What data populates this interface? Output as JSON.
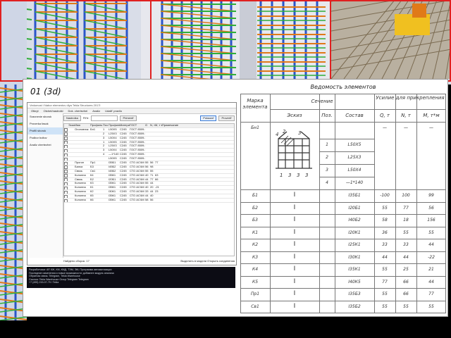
{
  "slide": {
    "title": "01 (3d)"
  },
  "app": {
    "window_title": "Vedomost i Nabor elementov dlya Tekla Structures 2017i",
    "menu": [
      "Otkryt",
      "Otchet/nastroiki",
      "Dok. chertezhei",
      "Analiz",
      "Udalit' pravilo"
    ],
    "sidebar": [
      "Sravnenie sborok",
      "Proverka fasok",
      "Profili sborok",
      "Podbor boltov",
      "Analiz chertezhei"
    ],
    "sidebar_selected": 2,
    "toolbar": {
      "settings": "Nastroika",
      "filter_label": "Fil'tr:",
      "apply": "Primenit'",
      "load": "Pokazat'",
      "check": "Proverit'"
    },
    "grid_headers": [
      "",
      "Эскиз",
      "Имя",
      "Профиль",
      "Поз",
      "Профиль",
      "Материал",
      "ГОСТ",
      "G",
      "N, т",
      "M, т·м",
      "Примечание"
    ],
    "grid_rows": [
      [
        "",
        "",
        "Оголовник",
        "Бн1",
        "1",
        "L50X5",
        "С245",
        "ГОСТ 8509-93",
        "",
        "",
        "",
        ""
      ],
      [
        "",
        "",
        "",
        "",
        "2",
        "L25X3",
        "С245",
        "ГОСТ 8509-93",
        "",
        "",
        "",
        ""
      ],
      [
        "",
        "",
        "",
        "",
        "3",
        "L50X4",
        "С245",
        "ГОСТ 8509-93",
        "",
        "",
        "",
        ""
      ],
      [
        "",
        "",
        "",
        "",
        "1",
        "L50X5",
        "С245",
        "ГОСТ 8509-93",
        "",
        "",
        "",
        ""
      ],
      [
        "",
        "",
        "",
        "",
        "2",
        "L25X3",
        "С245",
        "ГОСТ 8509-93",
        "",
        "",
        "",
        ""
      ],
      [
        "",
        "",
        "",
        "",
        "3",
        "L50X4",
        "С245",
        "ГОСТ 8509-93",
        "",
        "",
        "",
        ""
      ],
      [
        "",
        "",
        "",
        "",
        "4",
        "—1*140",
        "С245",
        "ГОСТ 8509-93",
        "",
        "",
        "",
        ""
      ],
      [
        "",
        "",
        "",
        "",
        "",
        "L50X5",
        "С245",
        "ГОСТ 8509-93",
        "",
        "",
        "",
        ""
      ],
      [
        "",
        "",
        "Прогон",
        "Пр1",
        "",
        "I35Б1",
        "С245",
        "СТО АСЧМ 20-93",
        "55",
        "56",
        "77",
        ""
      ],
      [
        "",
        "",
        "Балка",
        "Б3",
        "",
        "I45Б2",
        "С245",
        "СТО АСЧМ 20-93",
        "56",
        "98",
        "",
        ""
      ],
      [
        "",
        "",
        "Связь",
        "Св1",
        "",
        "I45Б2",
        "С245",
        "СТО АСЧМ 20-93",
        "55",
        "55",
        "",
        ""
      ],
      [
        "",
        "",
        "Колонна",
        "К4",
        "",
        "I35К1",
        "С245",
        "СТО АСЧМ 20-93",
        "40",
        "71",
        "63",
        ""
      ],
      [
        "",
        "",
        "Связь",
        "Б2",
        "",
        "I20Б1",
        "С245",
        "СТО АСЧМ 20-93",
        "44",
        "77",
        "66",
        ""
      ],
      [
        "",
        "",
        "Колонна",
        "К3",
        "",
        "I35К1",
        "С245",
        "СТО АСЧМ 20-93",
        "55",
        "44",
        "",
        ""
      ],
      [
        "",
        "",
        "Колонна",
        "К1",
        "",
        "I35К1",
        "С245",
        "СТО АСЧМ 20-93",
        "40",
        "20",
        "-21",
        ""
      ],
      [
        "",
        "",
        "Колонна",
        "К2",
        "",
        "I30К1",
        "С245",
        "СТО АСЧМ 20-93",
        "33",
        "44",
        "23",
        ""
      ],
      [
        "",
        "",
        "Колонна",
        "К5",
        "",
        "I35К1",
        "С245",
        "СТО АСЧМ 20-93",
        "44",
        "40",
        "",
        ""
      ],
      [
        "",
        "",
        "Колонна",
        "К6",
        "",
        "I35К1",
        "С245",
        "СТО АСЧМ 20-93",
        "58",
        "56",
        "",
        ""
      ]
    ],
    "footer_left": "Найдено сборок: 17",
    "footer_right": "Выделить в модели    Открыть соединения"
  },
  "console_lines": [
    "Разработчики: АР, КЖ, КМ, КМД, ТЭМ, ЭМ, Программа автоматизации",
    "Последние изменения и новые возможности: добавлен модуль анализа",
    "Обратная связь: Telegram, Tekla Warehouse",
    "Ссылка: Tekla Warehouse Group Telegram    Telegram",
    "+7 (495) 215-07-79 / Tekla"
  ],
  "statement": {
    "title": "Ведомость элементов",
    "h_mark": "Марка элемента",
    "h_section": "Сечение",
    "h_force": "Усилие для прикрепления",
    "h_sketch": "Эскиз",
    "h_pos": "Поз.",
    "h_comp": "Состав",
    "h_q": "Q, т",
    "h_n": "N, т",
    "h_m": "M, т*м",
    "group": {
      "mark": "Бн1",
      "sketch_labels": [
        "4",
        "2",
        "3",
        "1",
        "3",
        "3",
        "3"
      ],
      "rows": [
        {
          "pos": "1",
          "comp": "L50X5"
        },
        {
          "pos": "2",
          "comp": "L25X3"
        },
        {
          "pos": "3",
          "comp": "L50X4"
        },
        {
          "pos": "4",
          "comp": "—1*140"
        }
      ],
      "q": "—",
      "n": "—",
      "m": "—"
    },
    "rows": [
      {
        "mark": "Б1",
        "comp": "I35Б1",
        "q": "-100",
        "n": "100",
        "m": "99"
      },
      {
        "mark": "Б2",
        "comp": "I20Б1",
        "q": "55",
        "n": "77",
        "m": "56"
      },
      {
        "mark": "Б3",
        "comp": "I40Б2",
        "q": "58",
        "n": "18",
        "m": "156"
      },
      {
        "mark": "К1",
        "comp": "I20К1",
        "q": "36",
        "n": "55",
        "m": "55"
      },
      {
        "mark": "К2",
        "comp": "I25К1",
        "q": "33",
        "n": "33",
        "m": "44"
      },
      {
        "mark": "К3",
        "comp": "I30К1",
        "q": "44",
        "n": "44",
        "m": "-22"
      },
      {
        "mark": "К4",
        "comp": "I35К1",
        "q": "55",
        "n": "25",
        "m": "21"
      },
      {
        "mark": "К5",
        "comp": "I40К5",
        "q": "77",
        "n": "66",
        "m": "44"
      },
      {
        "mark": "Пр1",
        "comp": "I35Б3",
        "q": "55",
        "n": "66",
        "m": "77"
      },
      {
        "mark": "Св1",
        "comp": "I35Б2",
        "q": "55",
        "n": "55",
        "m": "55"
      }
    ],
    "beam_symbol": "I"
  },
  "colors": {
    "frame_red": "#e02020",
    "steel_green": "#2fae3a",
    "steel_orange": "#e07a18",
    "steel_blue": "#2a55c8",
    "floor_yellow": "#f0c020"
  }
}
